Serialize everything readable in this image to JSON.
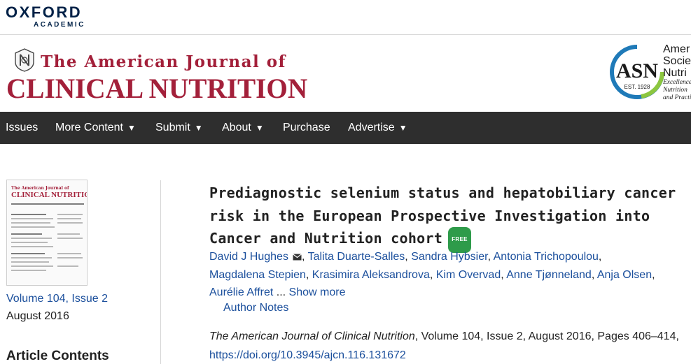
{
  "brand": {
    "publisher_word": "OXFORD",
    "publisher_sub": "ACADEMIC"
  },
  "journal": {
    "title_top": "The American Journal of",
    "title_main": "CLINICAL NUTRITION"
  },
  "society": {
    "logo_text": "ASN",
    "est": "EST. 1928",
    "name_lines": [
      "Amer",
      "Societ",
      "Nutri"
    ],
    "tagline_lines": [
      "Excellence",
      "Nutrition",
      "and Practi"
    ]
  },
  "nav": {
    "items": [
      {
        "label": "Issues",
        "dropdown": false
      },
      {
        "label": "More Content",
        "dropdown": true
      },
      {
        "label": "Submit",
        "dropdown": true
      },
      {
        "label": "About",
        "dropdown": true
      },
      {
        "label": "Purchase",
        "dropdown": false
      },
      {
        "label": "Advertise",
        "dropdown": true
      }
    ],
    "caret": "▼"
  },
  "sidebar": {
    "cover_title_top": "The American Journal of",
    "cover_title_main": "CLINICAL NUTRITION",
    "volume_link": "Volume 104, Issue 2",
    "issue_date": "August 2016",
    "contents_heading": "Article Contents"
  },
  "article": {
    "title_lines": [
      "Prediagnostic selenium status and hepatobiliary cancer",
      "risk in the European Prospective Investigation into",
      "Cancer and Nutrition cohort"
    ],
    "free_badge": "FREE",
    "authors": [
      "David J Hughes",
      "Talita Duarte-Salles",
      "Sandra Hybsier",
      "Antonia Trichopoulou",
      "Magdalena Stepien",
      "Krasimira Aleksandrova",
      "Kim Overvad",
      "Anne Tjønneland",
      "Anja Olsen",
      "Aurélie Affret"
    ],
    "ellipsis": " ...",
    "show_more": "Show more",
    "author_notes": "Author Notes",
    "citation_journal": "The American Journal of Clinical Nutrition",
    "citation_rest": ", Volume 104, Issue 2, August 2016, Pages 406–414, ",
    "doi": "https://doi.org/10.3945/ajcn.116.131672"
  },
  "colors": {
    "journal_red": "#a3203a",
    "nav_bg": "#2e2e2e",
    "link_blue": "#1b4f9c",
    "free_green": "#2e9b4a",
    "oxford_navy": "#002147"
  }
}
